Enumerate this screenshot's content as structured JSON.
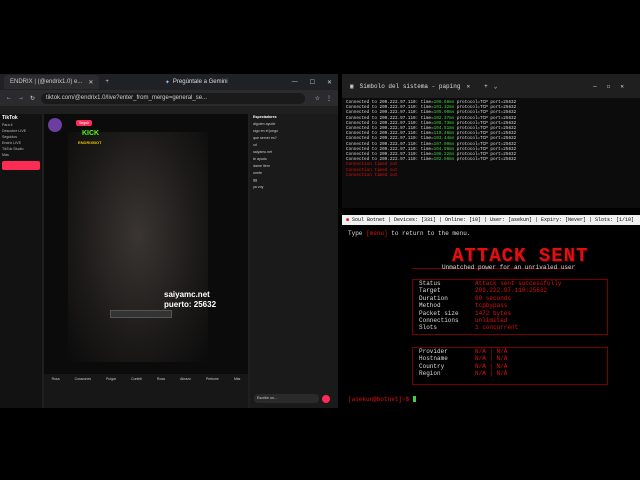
{
  "browser": {
    "tab1": "ENDRIX | (@endrix1.0) e...",
    "tab2": "Pregúntale a Gemini",
    "url": "tiktok.com/@endrix1.0/live?enter_from_merge=general_se...",
    "sidebar": [
      "TikTok",
      "Para ti",
      "Descubre LIVE",
      "Seguidos",
      "Endrix LIVE",
      "TikTok Studio",
      "Más"
    ],
    "live_badge": "Seguir",
    "stream_title": "KICK",
    "stream_sub": "ENDRIXBOT",
    "server_text": "saiyamc.net",
    "port_text": "puerto: 25632",
    "bottom_items": [
      "Rosa",
      "Corazones",
      "Pulgar",
      "Confeti",
      "Rosa",
      "Abrazo",
      "Perfume",
      "Más"
    ],
    "chat_header": "Espectadores",
    "chat_msgs": [
      "alguien ayude",
      "sigo en el juego",
      "que server es?",
      "xd",
      "saiyamc.net",
      "te ayudo",
      "dame item",
      "unete",
      "gg",
      "ya voy"
    ],
    "chat_input": "Escribe un..."
  },
  "term1": {
    "title": "Símbolo del sistema - paping",
    "lines": [
      {
        "text": "Connected to 209.222.97.110: time=",
        "time": "106.68ms",
        "rest": " protocol=TCP port=25632"
      },
      {
        "text": "Connected to 209.222.97.110: time=",
        "time": "101.32ms",
        "rest": " protocol=TCP port=25632"
      },
      {
        "text": "Connected to 209.222.97.110: time=",
        "time": "105.90ms",
        "rest": " protocol=TCP port=25632"
      },
      {
        "text": "Connected to 209.222.97.110: time=",
        "time": "102.37ms",
        "rest": " protocol=TCP port=25632"
      },
      {
        "text": "Connected to 209.222.97.110: time=",
        "time": "108.73ms",
        "rest": " protocol=TCP port=25632"
      },
      {
        "text": "Connected to 209.222.97.110: time=",
        "time": "104.51ms",
        "rest": " protocol=TCP port=25632"
      },
      {
        "text": "Connected to 209.222.97.110: time=",
        "time": "110.46ms",
        "rest": " protocol=TCP port=25632"
      },
      {
        "text": "Connected to 209.222.97.110: time=",
        "time": "103.44ms",
        "rest": " protocol=TCP port=25632"
      },
      {
        "text": "Connected to 209.222.97.110: time=",
        "time": "107.09ms",
        "rest": " protocol=TCP port=25632"
      },
      {
        "text": "Connected to 209.222.97.110: time=",
        "time": "104.98ms",
        "rest": " protocol=TCP port=25632"
      },
      {
        "text": "Connected to 209.222.97.110: time=",
        "time": "106.22ms",
        "rest": " protocol=TCP port=25632"
      },
      {
        "text": "Connected to 209.222.97.110: time=",
        "time": "102.50ms",
        "rest": " protocol=TCP port=25632"
      }
    ],
    "timeouts": [
      "Connection timed out",
      "Connection timed out",
      "Connection timed out"
    ]
  },
  "term2": {
    "title": "Soul Botnet | Devices: [331] | Online: [10] | User: [asekun] | Expiry: [Never] | Slots: [1/10]",
    "prompt_line_pre": "Type ",
    "prompt_word": "[menu]",
    "prompt_line_post": " to return to the menu.",
    "banner": "ATTACK SENT",
    "tagline": "Unmatched power for an unrivaled user",
    "fields": [
      {
        "k": "Status",
        "v": "Attack sent successfully"
      },
      {
        "k": "Target",
        "v": "209.222.97.110:25632"
      },
      {
        "k": "Duration",
        "v": "60 seconds"
      },
      {
        "k": "Method",
        "v": "tcpbypass"
      },
      {
        "k": "Packet size",
        "v": "1472 bytes"
      },
      {
        "k": "Connections",
        "v": "unlimited"
      },
      {
        "k": "Slots",
        "v": "1 concurrent"
      }
    ],
    "info": [
      {
        "k": "Provider",
        "v": "N/A | N/A"
      },
      {
        "k": "Hostname",
        "v": "N/A | N/A"
      },
      {
        "k": "Country",
        "v": "N/A | N/A"
      },
      {
        "k": "Region",
        "v": "N/A | N/A"
      }
    ],
    "shell_prompt": "[asekun@botnet]~$"
  },
  "colors": {
    "accent": "#e01010",
    "green": "#3fd13f",
    "tiktok": "#fe2c55"
  }
}
